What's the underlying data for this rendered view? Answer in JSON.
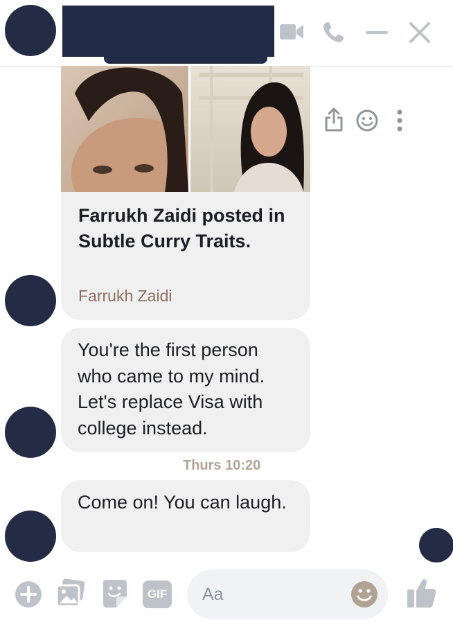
{
  "post_card": {
    "title": "Farrukh Zaidi posted in Subtle Curry Traits.",
    "source": "Farrukh Zaidi"
  },
  "messages": [
    {
      "text": "You're the first person who came to my mind. Let's replace Visa with college instead."
    },
    {
      "text": "Come on! You can laugh."
    }
  ],
  "timestamp": "Thurs 10:20",
  "composer": {
    "placeholder": "Aa",
    "gif_label": "GIF"
  },
  "colors": {
    "accent": "#b1a394",
    "bubble": "#f1f0f0",
    "avatar": "#232c44"
  }
}
